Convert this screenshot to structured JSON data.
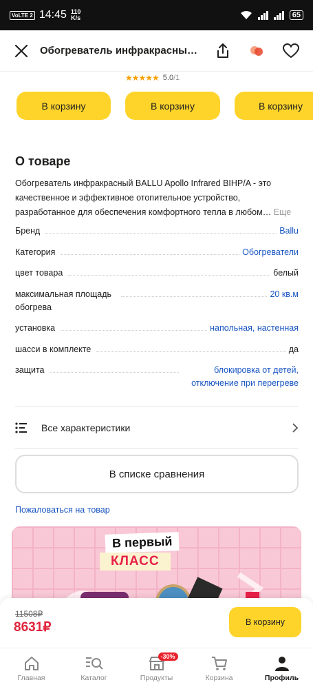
{
  "status": {
    "time": "14:45",
    "volte": "VoLTE 2",
    "speed_top": "110",
    "speed_bottom": "K/s",
    "battery": "65"
  },
  "header": {
    "title": "Обогреватель инфракрасный BALLU Apollo Infrared BIHP/A"
  },
  "rating": {
    "stars": "★★★★★",
    "score": "5.0",
    "count": "/1"
  },
  "carousel": {
    "buttons": [
      "В корзину",
      "В корзину",
      "В корзину"
    ]
  },
  "about": {
    "title": "О товаре",
    "description": "Обогреватель инфракрасный BALLU Apollo Infrared BIHP/A - это качественное и эффективное отопительное устройство, разработанное для обеспечения комфортного тепла в любом…",
    "more": "Еще"
  },
  "specs": [
    {
      "label": "Бренд",
      "value": "Ballu"
    },
    {
      "label": "Категория",
      "value": "Обогреватели"
    },
    {
      "label": "цвет товара",
      "value": "белый"
    },
    {
      "label": "максимальная площадь обогрева",
      "value": "20 кв.м"
    },
    {
      "label": "установка",
      "value": "напольная, настенная"
    },
    {
      "label": "шасси в комплекте",
      "value": "да"
    },
    {
      "label": "защита",
      "value": "блокировка от детей, отключение при перегреве"
    }
  ],
  "all_specs_label": "Все характеристики",
  "compare_label": "В списке сравнения",
  "report_label": "Пожаловаться на товар",
  "banner": {
    "line1": "В первый",
    "line2": "КЛАСС"
  },
  "purchase": {
    "old_price": "11508₽",
    "price": "8631₽",
    "buy_label": "В корзину"
  },
  "tabs": [
    {
      "label": "Главная",
      "icon": "home-icon"
    },
    {
      "label": "Каталог",
      "icon": "catalog-search-icon"
    },
    {
      "label": "Продукты",
      "icon": "shop-icon",
      "badge": "-30%"
    },
    {
      "label": "Корзина",
      "icon": "cart-icon"
    },
    {
      "label": "Профиль",
      "icon": "profile-icon"
    }
  ],
  "colors": {
    "accent_yellow": "#fed42b",
    "price_red": "#e0233c",
    "link_blue": "#1a56c2"
  }
}
